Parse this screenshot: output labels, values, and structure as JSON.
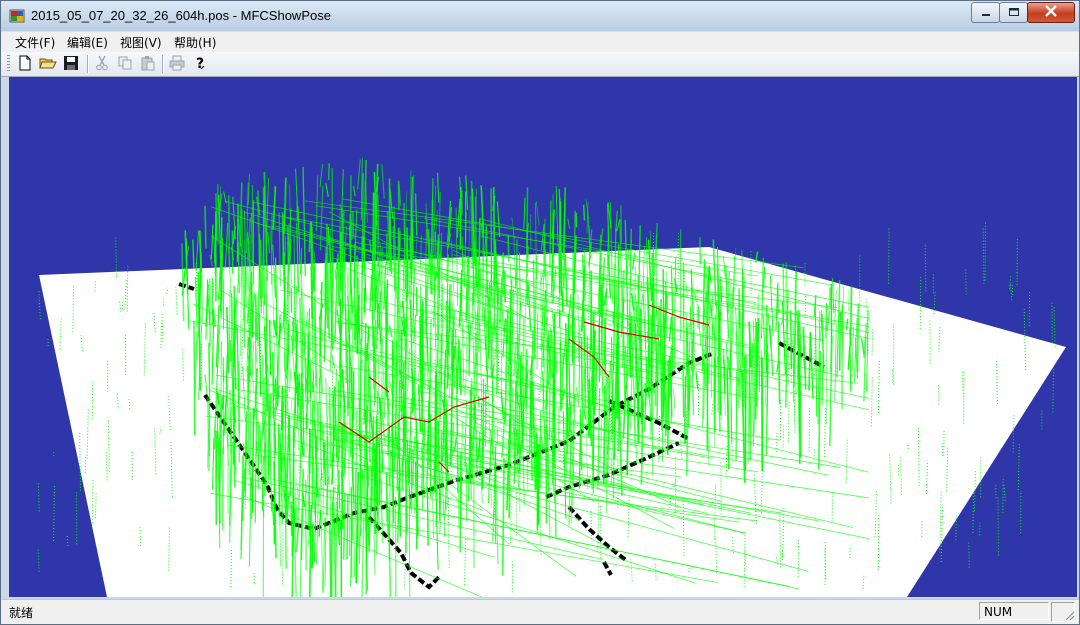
{
  "window": {
    "title": "2015_05_07_20_32_26_604h.pos - MFCShowPose",
    "app_icon": "mfc-app-icon",
    "caption_buttons": [
      "minimize-icon",
      "maximize-icon",
      "close-icon"
    ]
  },
  "menu": {
    "items": [
      {
        "label": "文件(F)"
      },
      {
        "label": "编辑(E)"
      },
      {
        "label": "视图(V)"
      },
      {
        "label": "帮助(H)"
      }
    ]
  },
  "toolbar": {
    "buttons": [
      {
        "icon": "new-file-icon",
        "enabled": true
      },
      {
        "icon": "open-folder-icon",
        "enabled": true
      },
      {
        "icon": "save-icon",
        "enabled": true
      },
      {
        "icon": "cut-icon",
        "enabled": false
      },
      {
        "icon": "copy-icon",
        "enabled": false
      },
      {
        "icon": "paste-icon",
        "enabled": false
      },
      {
        "icon": "print-icon",
        "enabled": false
      },
      {
        "icon": "help-icon",
        "enabled": true
      }
    ]
  },
  "viewport": {
    "background_color": "#2f36a9",
    "ground_color": "#ffffff",
    "point_cloud_color": "#00ff00",
    "trajectory_color": "#d40000",
    "wall_color": "#000000"
  },
  "status": {
    "text": "就绪",
    "num_indicator": "NUM"
  }
}
